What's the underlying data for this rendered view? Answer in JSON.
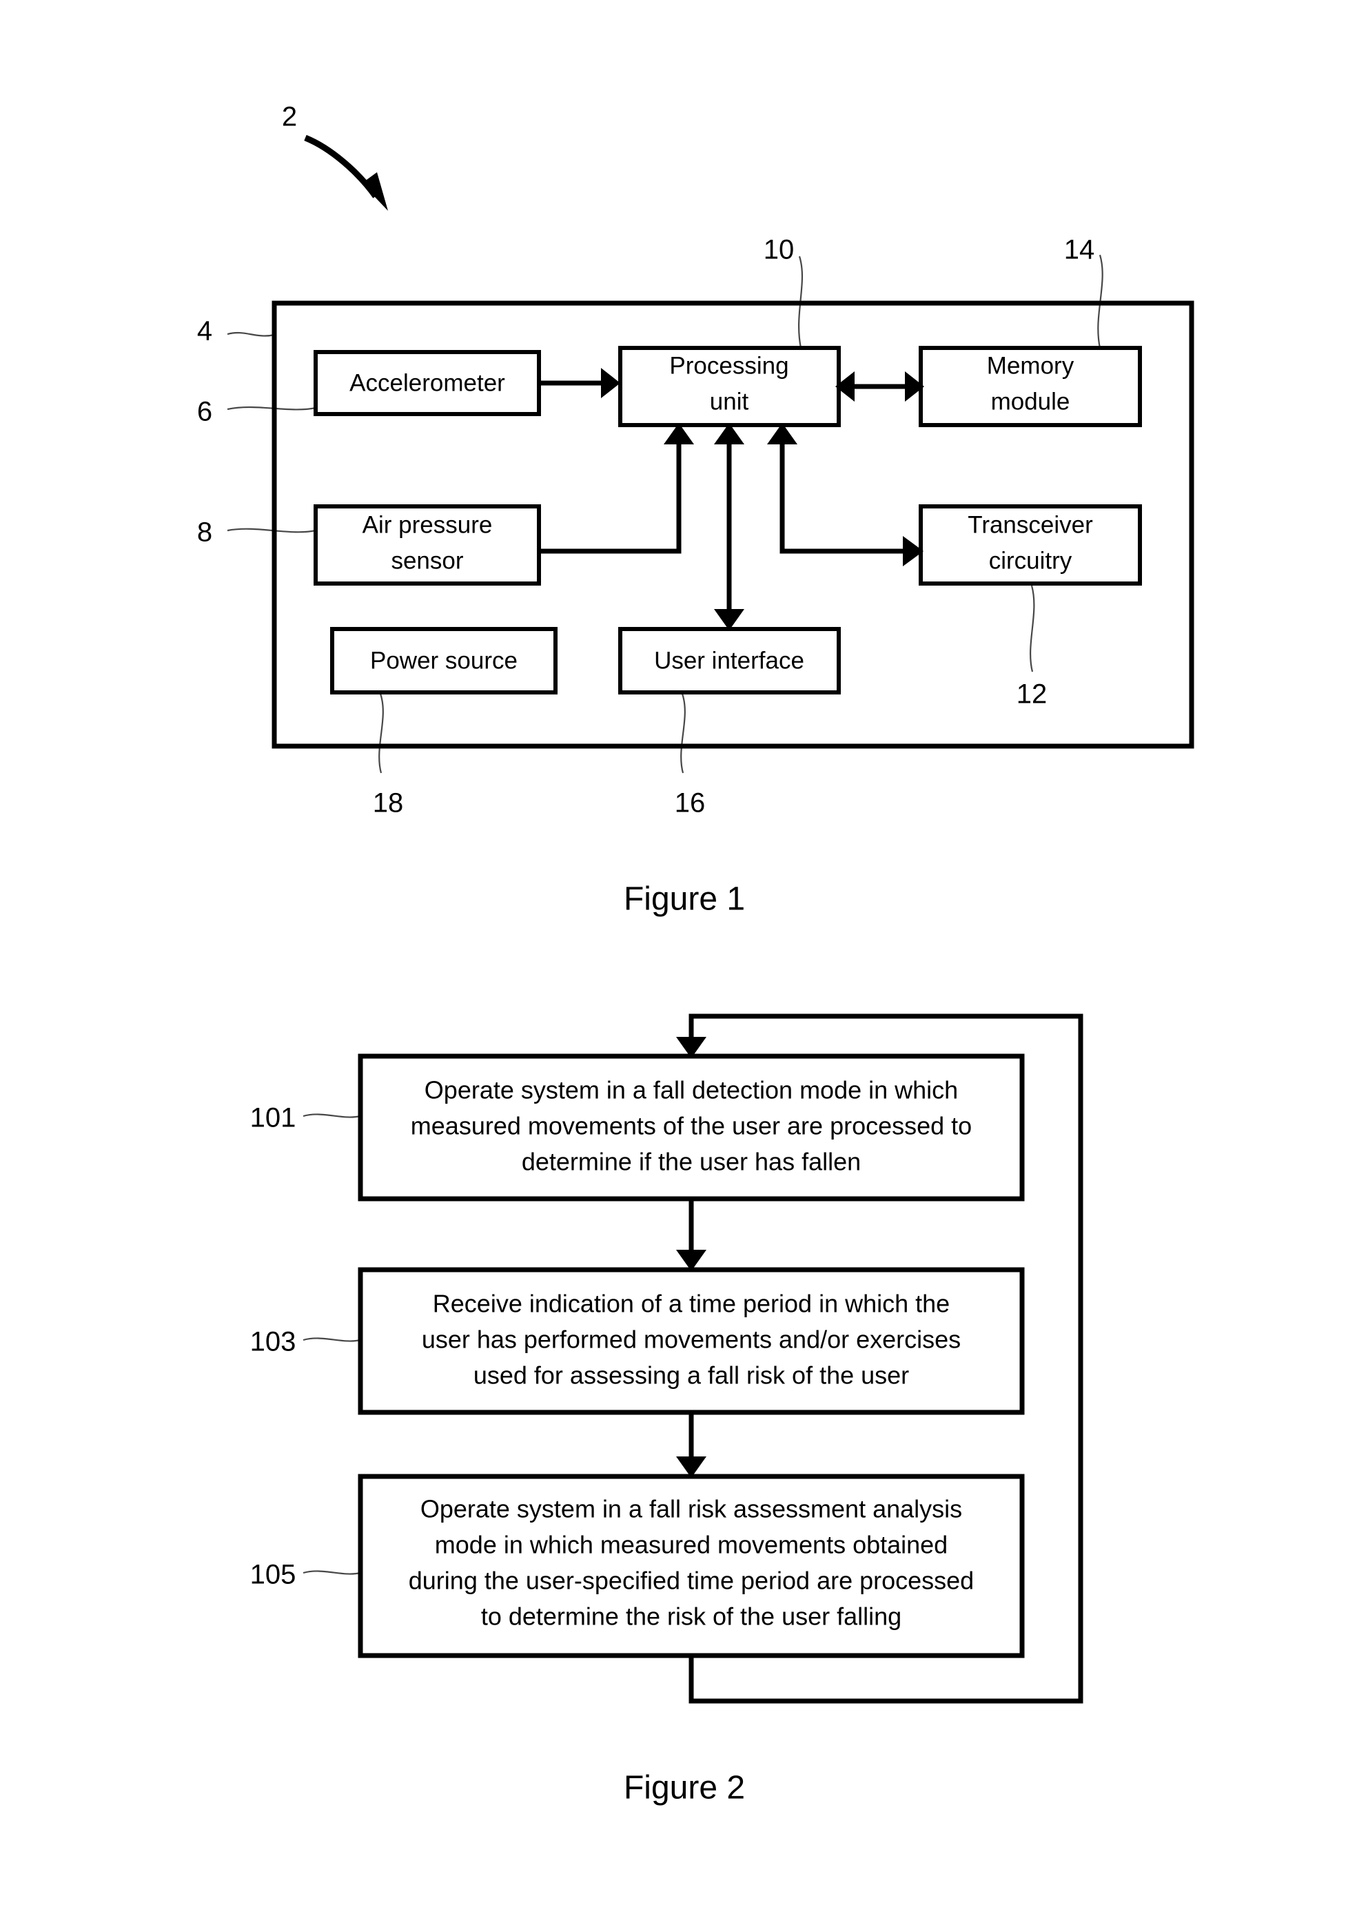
{
  "figures": [
    {
      "id": "figure-1",
      "caption": "Figure 1",
      "system_ref": "2",
      "device_ref": "4",
      "blocks": [
        {
          "key": "accelerometer",
          "label": "Accelerometer",
          "ref": "6"
        },
        {
          "key": "processing_unit",
          "label_line1": "Processing",
          "label_line2": "unit",
          "ref": "10"
        },
        {
          "key": "memory_module",
          "label_line1": "Memory",
          "label_line2": "module",
          "ref": "14"
        },
        {
          "key": "air_pressure",
          "label_line1": "Air pressure",
          "label_line2": "sensor",
          "ref": "8"
        },
        {
          "key": "transceiver",
          "label_line1": "Transceiver",
          "label_line2": "circuitry",
          "ref": "12"
        },
        {
          "key": "power_source",
          "label": "Power source",
          "ref": "18"
        },
        {
          "key": "user_interface",
          "label": "User interface",
          "ref": "16"
        }
      ]
    },
    {
      "id": "figure-2",
      "caption": "Figure 2",
      "steps": [
        {
          "ref": "101",
          "lines": [
            "Operate system in a fall detection mode in which",
            "measured movements of the user are processed to",
            "determine if the user has fallen"
          ]
        },
        {
          "ref": "103",
          "lines": [
            "Receive indication of a time period in which the",
            "user has performed movements and/or exercises",
            "used for assessing a fall risk of the user"
          ]
        },
        {
          "ref": "105",
          "lines": [
            "Operate system in a fall risk assessment analysis",
            "mode in which measured movements obtained",
            "during the user-specified time period are processed",
            "to determine the risk of the user falling"
          ]
        }
      ]
    }
  ],
  "colors": {
    "ink": "#000000",
    "paper": "#ffffff"
  }
}
